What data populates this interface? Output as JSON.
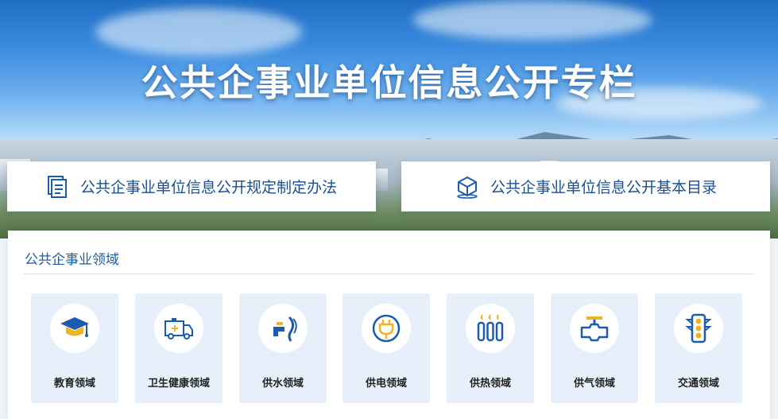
{
  "banner": {
    "title": "公共企事业单位信息公开专栏"
  },
  "links": [
    {
      "label": "公共企事业单位信息公开规定制定办法",
      "icon": "document-stack-icon"
    },
    {
      "label": "公共企事业单位信息公开基本目录",
      "icon": "cube-icon"
    }
  ],
  "section": {
    "title": "公共企事业领域",
    "items": [
      {
        "label": "教育领域",
        "icon": "graduation-cap-icon"
      },
      {
        "label": "卫生健康领域",
        "icon": "ambulance-icon"
      },
      {
        "label": "供水领域",
        "icon": "water-tap-icon"
      },
      {
        "label": "供电领域",
        "icon": "power-plug-icon"
      },
      {
        "label": "供热领域",
        "icon": "radiator-icon"
      },
      {
        "label": "供气领域",
        "icon": "gas-valve-icon"
      },
      {
        "label": "交通领域",
        "icon": "traffic-light-icon"
      }
    ]
  },
  "colors": {
    "accent_blue": "#1a5fa6",
    "icon_blue": "#1c5cae",
    "icon_yellow": "#f0b323",
    "tile_bg": "#e7f0fa"
  }
}
